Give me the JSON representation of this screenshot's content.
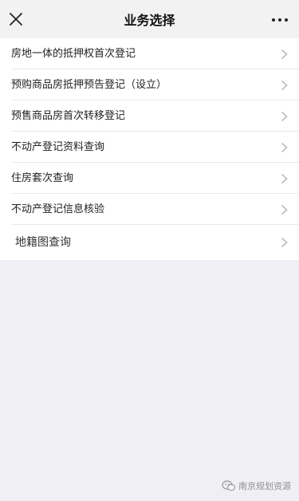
{
  "header": {
    "title": "业务选择",
    "close_icon": "close-icon",
    "more_icon": "more-horizontal-icon"
  },
  "list": {
    "items": [
      {
        "label": "房地一体的抵押权首次登记"
      },
      {
        "label": "预购商品房抵押预告登记（设立）"
      },
      {
        "label": "预售商品房首次转移登记"
      },
      {
        "label": "不动产登记资料查询"
      },
      {
        "label": "住房套次查询"
      },
      {
        "label": "不动产登记信息核验"
      },
      {
        "label": "地籍图查询"
      }
    ],
    "chevron_icon": "chevron-right-icon"
  },
  "watermark": {
    "text": "南京规划资源",
    "icon": "wechat-official-account-icon"
  },
  "colors": {
    "header_bg": "#f2f2f2",
    "page_bg": "#efeff4",
    "list_bg": "#ffffff",
    "separator": "#e8e8e8",
    "chevron": "#b2b2b2"
  }
}
